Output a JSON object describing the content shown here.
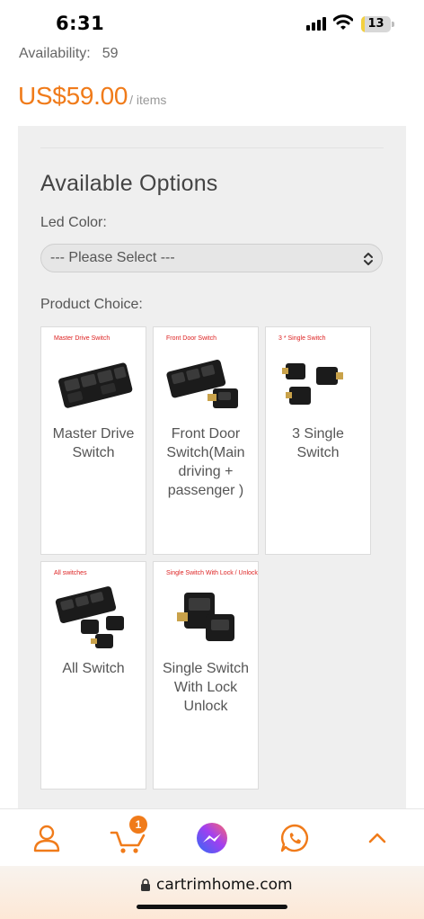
{
  "status_bar": {
    "time": "6:31",
    "battery": "13",
    "battery_level_percent": 13
  },
  "product": {
    "availability_label": "Availability:",
    "availability_value": "59",
    "price": "US$59.00",
    "per_unit": "/ items"
  },
  "options": {
    "title": "Available Options",
    "led_color_label": "Led Color:",
    "led_color_select": {
      "value": "--- Please Select ---"
    },
    "product_choice_label": "Product Choice:",
    "choices": [
      {
        "caption": "Master Drive Switch",
        "label": "Master Drive Switch"
      },
      {
        "caption": "Front Door Switch",
        "label": "Front Door Switch(Main driving + passenger )"
      },
      {
        "caption": "3 * Single Switch",
        "label": "3 Single Switch"
      },
      {
        "caption": "All switches",
        "label": "All Switch"
      },
      {
        "caption": "Single Switch With Lock / Unlock",
        "label": "Single Switch With Lock Unlock"
      }
    ]
  },
  "bottom_nav": {
    "items": [
      "account-icon",
      "cart-icon",
      "messenger-icon",
      "whatsapp-icon",
      "scroll-top-icon"
    ],
    "cart_count": "1",
    "accent_color": "#f07b1a"
  },
  "browser": {
    "url": "cartrimhome.com"
  }
}
